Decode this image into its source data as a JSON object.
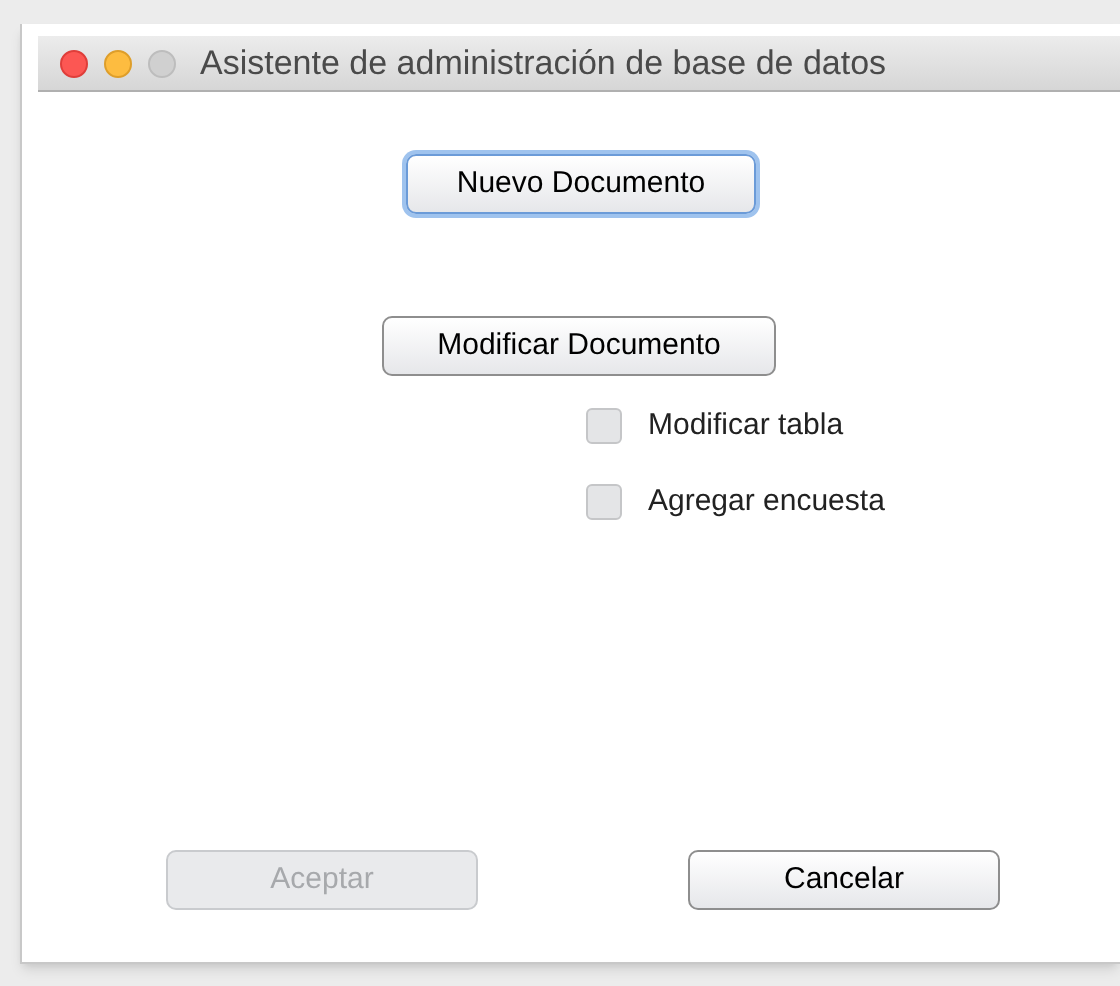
{
  "window": {
    "title": "Asistente de administración de base de datos"
  },
  "new_button": {
    "label": "Nuevo Documento",
    "focused": true,
    "disabled": false
  },
  "modify_button": {
    "label": "Modificar Documento",
    "focused": false,
    "disabled": false
  },
  "options": [
    {
      "label": "Modificar tabla",
      "checked": false
    },
    {
      "label": "Agregar encuesta",
      "checked": false
    }
  ],
  "footer_buttons": [
    {
      "label": "Aceptar",
      "focused": false,
      "disabled": true
    },
    {
      "label": "Cancelar",
      "focused": false,
      "disabled": false
    }
  ]
}
